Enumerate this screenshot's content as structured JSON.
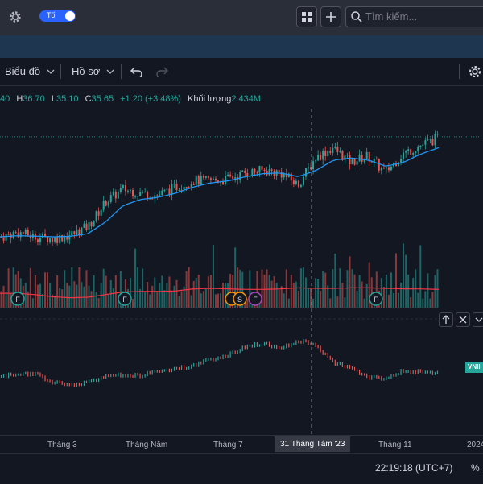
{
  "header": {
    "theme_toggle_label": "Tối",
    "search_placeholder": "Tìm kiếm..."
  },
  "toolbar": {
    "chart_label": "Biểu đồ",
    "profile_label": "Hồ sơ"
  },
  "legend": {
    "open": "40",
    "high_label": "H",
    "high": "36.70",
    "low_label": "L",
    "low": "35.10",
    "close_label": "C",
    "close": "35.65",
    "change": "+1.20 (+3.48%)",
    "volume_label": "Khối lượng",
    "volume": "2.434M"
  },
  "event_markers": [
    {
      "label": "F"
    },
    {
      "label": "F"
    },
    {
      "label": "S"
    },
    {
      "label": "F"
    },
    {
      "label": "F"
    }
  ],
  "comparison_tag": "VNII",
  "xaxis": {
    "ticks": [
      "Tháng 3",
      "Tháng Năm",
      "Tháng 7",
      "Tháng 11",
      "2024"
    ],
    "crosshair_label": "31 Tháng Tám '23"
  },
  "status": {
    "clock": "22:19:18 (UTC+7)",
    "percent_label": "%"
  },
  "colors": {
    "up": "#26a69a",
    "down": "#ef5350",
    "ma": "#2196f3",
    "volume_ma": "#f23645",
    "accent": "#2962ff"
  },
  "chart_data": {
    "type": "line",
    "price_series": {
      "name": "",
      "x": [
        "2023-01-03",
        "2023-01-17",
        "2023-01-31",
        "2023-02-14",
        "2023-02-28",
        "2023-03-14",
        "2023-03-28",
        "2023-04-11",
        "2023-04-25",
        "2023-05-09",
        "2023-05-23",
        "2023-06-06",
        "2023-06-20",
        "2023-07-04",
        "2023-07-18",
        "2023-08-01",
        "2023-08-15",
        "2023-08-29",
        "2023-09-12",
        "2023-09-26",
        "2023-10-10",
        "2023-10-24",
        "2023-11-07",
        "2023-11-21",
        "2023-12-05",
        "2023-12-19"
      ],
      "close": [
        30.9,
        31.1,
        30.9,
        30.8,
        31.0,
        31.4,
        32.6,
        33.2,
        33.0,
        32.9,
        33.3,
        33.6,
        33.6,
        33.7,
        34.0,
        34.1,
        34.0,
        33.4,
        34.7,
        35.2,
        34.5,
        34.8,
        34.0,
        34.9,
        35.3,
        35.65
      ]
    },
    "ma_series": {
      "values": [
        30.9,
        30.95,
        30.93,
        30.9,
        30.92,
        31.05,
        31.6,
        32.4,
        32.7,
        32.8,
        33.0,
        33.3,
        33.5,
        33.6,
        33.8,
        33.95,
        33.98,
        33.8,
        34.1,
        34.6,
        34.7,
        34.6,
        34.3,
        34.5,
        34.9,
        35.2
      ]
    },
    "volume_ma": [
      0.55,
      0.55,
      0.5,
      0.42,
      0.38,
      0.4,
      0.5,
      0.6,
      0.62,
      0.62,
      0.64,
      0.72,
      0.74,
      0.72,
      0.7,
      0.7,
      0.72,
      0.76,
      0.74,
      0.74,
      0.76,
      0.76,
      0.74,
      0.72,
      0.72,
      0.7
    ],
    "comparison_series": {
      "values": [
        34.0,
        34.3,
        34.2,
        33.4,
        33.0,
        33.5,
        34.0,
        34.2,
        34.1,
        34.6,
        34.8,
        35.2,
        35.8,
        36.3,
        37.2,
        37.5,
        37.0,
        37.8,
        37.4,
        35.5,
        34.9,
        33.9,
        33.8,
        34.6,
        34.5,
        34.3
      ]
    }
  }
}
